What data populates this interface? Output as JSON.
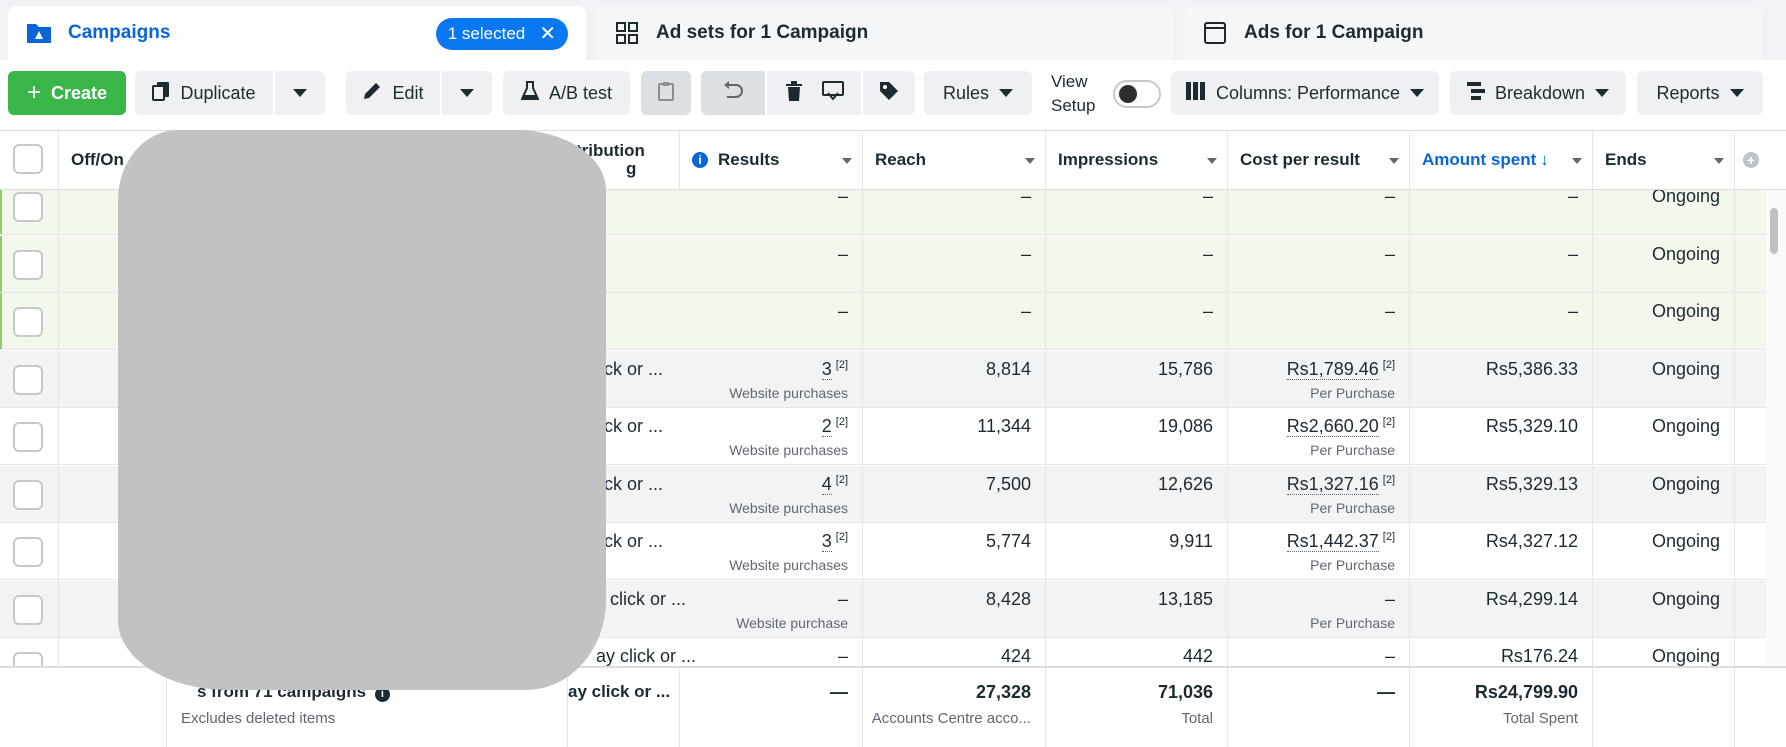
{
  "tabs": {
    "campaigns": {
      "label": "Campaigns",
      "selected_pill": "1 selected"
    },
    "adsets": {
      "label": "Ad sets for 1 Campaign"
    },
    "ads": {
      "label": "Ads for 1 Campaign"
    }
  },
  "toolbar": {
    "create": "Create",
    "duplicate": "Duplicate",
    "edit": "Edit",
    "abtest": "A/B test",
    "rules": "Rules",
    "view_setup_line1": "View",
    "view_setup_line2": "Setup",
    "columns": "Columns: Performance",
    "breakdown": "Breakdown",
    "reports": "Reports"
  },
  "header": {
    "offon": "Off/On",
    "attribution": "tribution",
    "attribution2": "g",
    "results": "Results",
    "reach": "Reach",
    "impressions": "Impressions",
    "cost": "Cost per result",
    "amount": "Amount spent",
    "ends": "Ends"
  },
  "rows": [
    {
      "style": "green",
      "attr": "",
      "results": "–",
      "results_sub": "",
      "reach": "–",
      "impressions": "–",
      "cost": "–",
      "cost_sub": "",
      "amount": "–",
      "ends": "Ongoing"
    },
    {
      "style": "green",
      "attr": "",
      "results": "–",
      "results_sub": "",
      "reach": "–",
      "impressions": "–",
      "cost": "–",
      "cost_sub": "",
      "amount": "–",
      "ends": "Ongoing"
    },
    {
      "style": "green",
      "attr": "",
      "results": "–",
      "results_sub": "",
      "reach": "–",
      "impressions": "–",
      "cost": "–",
      "cost_sub": "",
      "amount": "–",
      "ends": "Ongoing"
    },
    {
      "style": "gray",
      "attr": "lick or ...",
      "results": "3",
      "results_sub": "Website purchases",
      "reach": "8,814",
      "impressions": "15,786",
      "cost": "Rs1,789.46",
      "cost_sub": "Per Purchase",
      "amount": "Rs5,386.33",
      "ends": "Ongoing"
    },
    {
      "style": "white",
      "attr": "lick or ...",
      "results": "2",
      "results_sub": "Website purchases",
      "reach": "11,344",
      "impressions": "19,086",
      "cost": "Rs2,660.20",
      "cost_sub": "Per Purchase",
      "amount": "Rs5,329.10",
      "ends": "Ongoing"
    },
    {
      "style": "gray",
      "attr": "lick or ...",
      "results": "4",
      "results_sub": "Website purchases",
      "reach": "7,500",
      "impressions": "12,626",
      "cost": "Rs1,327.16",
      "cost_sub": "Per Purchase",
      "amount": "Rs5,329.13",
      "ends": "Ongoing"
    },
    {
      "style": "white",
      "attr": "lick or ...",
      "results": "3",
      "results_sub": "Website purchases",
      "reach": "5,774",
      "impressions": "9,911",
      "cost": "Rs1,442.37",
      "cost_sub": "Per Purchase",
      "amount": "Rs4,327.12",
      "ends": "Ongoing"
    },
    {
      "style": "gray",
      "attr": "y click or ...",
      "results": "–",
      "results_sub": "Website purchase",
      "reach": "8,428",
      "impressions": "13,185",
      "cost": "–",
      "cost_sub": "Per Purchase",
      "amount": "Rs4,299.14",
      "ends": "Ongoing"
    },
    {
      "style": "white",
      "attr": "ay click or ...",
      "results": "–",
      "results_sub": "",
      "reach": "424",
      "impressions": "442",
      "cost": "–",
      "cost_sub": "",
      "amount": "Rs176.24",
      "ends": "Ongoing"
    }
  ],
  "footer": {
    "label": "s from 71 campaigns",
    "excludes": "Excludes deleted items",
    "attr": "ay click or ...",
    "results": "—",
    "reach": "27,328",
    "reach_sub": "Accounts Centre acco...",
    "impressions": "71,036",
    "impressions_sub": "Total",
    "cost": "—",
    "amount": "Rs24,799.90",
    "amount_sub": "Total Spent"
  },
  "colors": {
    "accent_blue": "#0a66d8",
    "create_green": "#3ab54a",
    "selected_row_green": "#f2f9ec",
    "redaction_gray": "#c2c2c2"
  }
}
